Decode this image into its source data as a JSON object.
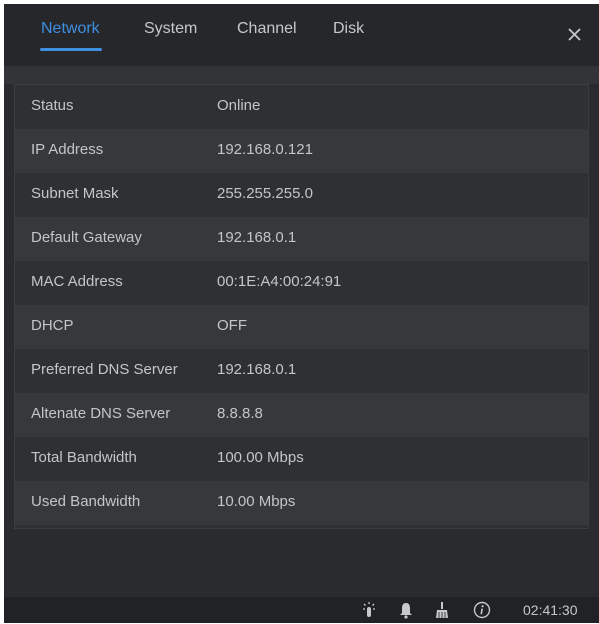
{
  "tabs": [
    {
      "label": "Network",
      "active": true
    },
    {
      "label": "System",
      "active": false
    },
    {
      "label": "Channel",
      "active": false
    },
    {
      "label": "Disk",
      "active": false
    }
  ],
  "close": {
    "glyph": "X",
    "icon": "close-icon"
  },
  "rows": [
    {
      "label": "Status",
      "value": "Online"
    },
    {
      "label": "IP Address",
      "value": "192.168.0.121"
    },
    {
      "label": "Subnet Mask",
      "value": "255.255.255.0"
    },
    {
      "label": "Default Gateway",
      "value": "192.168.0.1"
    },
    {
      "label": "MAC Address",
      "value": "00:1E:A4:00:24:91"
    },
    {
      "label": "DHCP",
      "value": "OFF"
    },
    {
      "label": "Preferred DNS Server",
      "value": "192.168.0.1"
    },
    {
      "label": "Altenate DNS Server",
      "value": "8.8.8.8"
    },
    {
      "label": "Total Bandwidth",
      "value": "100.00 Mbps"
    },
    {
      "label": "Used Bandwidth",
      "value": "10.00 Mbps"
    }
  ],
  "taskbar": {
    "icons": [
      "touch-icon",
      "alarm-bell-icon",
      "clear-broom-icon",
      "info-icon"
    ],
    "time": "02:41:30"
  },
  "colors": {
    "accent": "#3f8fe0",
    "background": "#2a2b2f",
    "text": "#c4c5c9"
  }
}
